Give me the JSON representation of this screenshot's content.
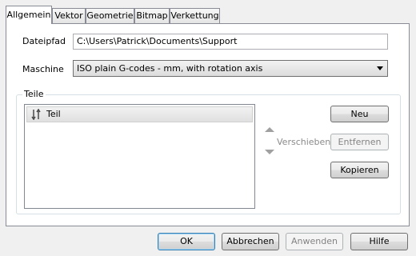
{
  "tabs": [
    {
      "label": "Allgemein",
      "active": true
    },
    {
      "label": "Vektor",
      "active": false
    },
    {
      "label": "Geometrie",
      "active": false
    },
    {
      "label": "Bitmap",
      "active": false
    },
    {
      "label": "Verkettung",
      "active": false
    }
  ],
  "general": {
    "filepath_label": "Dateipfad",
    "filepath_value": "C:\\Users\\Patrick\\Documents\\Support",
    "machine_label": "Maschine",
    "machine_value": "ISO plain G-codes - mm, with rotation axis"
  },
  "parts": {
    "group_title": "Teile",
    "items": [
      {
        "label": "Teil",
        "icon": "part-icon"
      }
    ],
    "move_label": "Verschieben",
    "new_label": "Neu",
    "remove_label": "Entfernen",
    "copy_label": "Kopieren"
  },
  "footer": {
    "ok_label": "OK",
    "cancel_label": "Abbrechen",
    "apply_label": "Anwenden",
    "help_label": "Hilfe"
  },
  "colors": {
    "accent_border": "#3c7fb1",
    "disabled_text": "#838383"
  }
}
